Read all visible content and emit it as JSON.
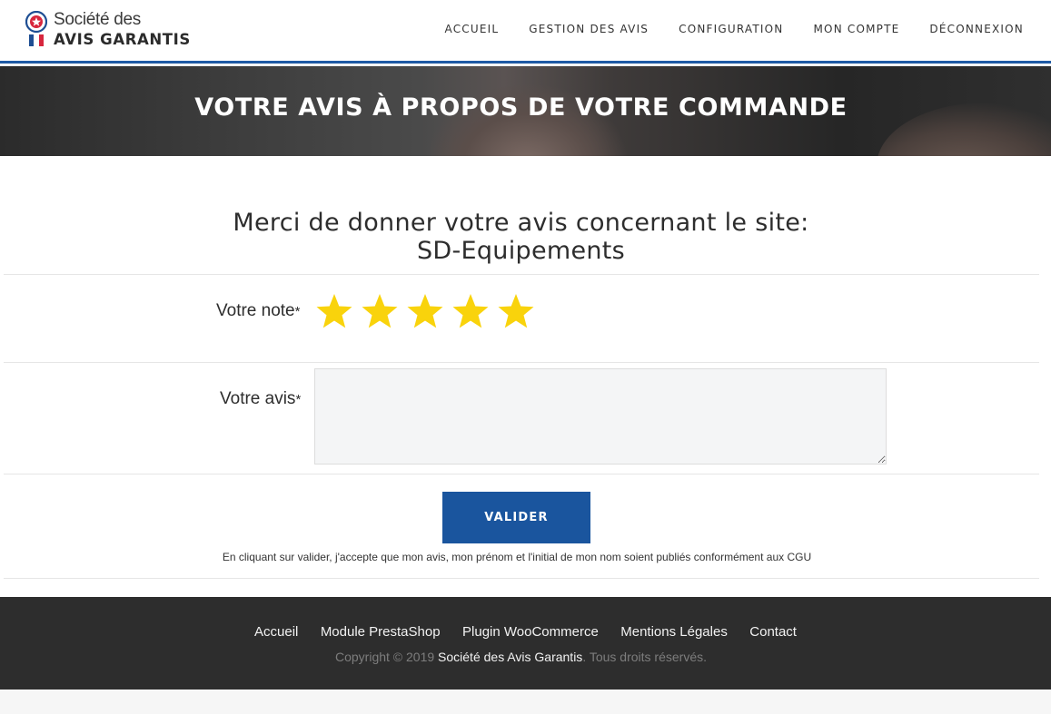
{
  "logo": {
    "line1": "Société des",
    "line2": "AVIS GARANTIS"
  },
  "nav": {
    "items": [
      {
        "label": "ACCUEIL"
      },
      {
        "label": "GESTION DES AVIS"
      },
      {
        "label": "CONFIGURATION"
      },
      {
        "label": "MON COMPTE"
      },
      {
        "label": "DÉCONNEXION"
      }
    ]
  },
  "hero": {
    "title": "VOTRE AVIS À PROPOS DE VOTRE COMMANDE"
  },
  "form": {
    "subtitle_line1": "Merci de donner votre avis concernant le site:",
    "subtitle_line2": "SD-Equipements",
    "rating_label": "Votre note",
    "rating_required": "*",
    "rating": {
      "value": 5,
      "max": 5
    },
    "review_label": "Votre avis",
    "review_required": "*",
    "review_value": "",
    "submit_label": "VALIDER",
    "disclaimer": "En cliquant sur valider, j'accepte que mon avis, mon prénom et l'initial de mon nom soient publiés conformément aux CGU"
  },
  "footer": {
    "links": [
      {
        "label": "Accueil"
      },
      {
        "label": "Module PrestaShop"
      },
      {
        "label": "Plugin WooCommerce"
      },
      {
        "label": "Mentions Légales"
      },
      {
        "label": "Contact"
      }
    ],
    "copyright_prefix": "Copyright © 2019",
    "copyright_brand": "Société des Avis Garantis",
    "copyright_suffix": ". Tous droits réservés."
  },
  "colors": {
    "accent": "#1a559e",
    "star": "#f9d30c",
    "footer_bg": "#2d2d2d"
  }
}
